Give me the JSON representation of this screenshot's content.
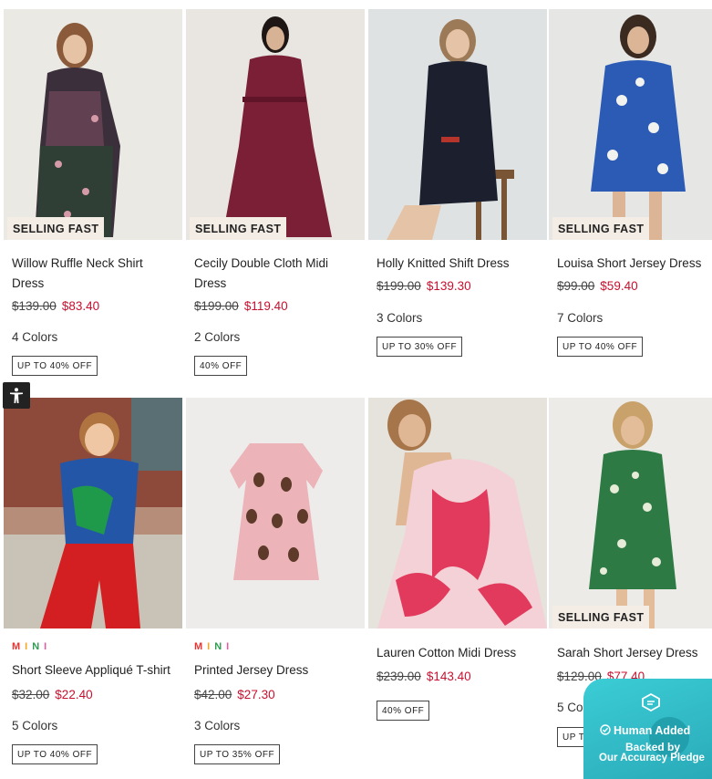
{
  "products": [
    {
      "badge": "SELLING FAST",
      "name": "Willow Ruffle Neck Shirt Dress",
      "was": "$139.00",
      "now": "$83.40",
      "colors": "4 Colors",
      "tag": "UP TO 40% OFF"
    },
    {
      "badge": "SELLING FAST",
      "name": "Cecily Double Cloth Midi Dress",
      "was": "$199.00",
      "now": "$119.40",
      "colors": "2 Colors",
      "tag": "40% OFF"
    },
    {
      "name": "Holly Knitted Shift Dress",
      "was": "$199.00",
      "now": "$139.30",
      "colors": "3 Colors",
      "tag": "UP TO 30% OFF"
    },
    {
      "badge": "SELLING FAST",
      "name": "Louisa Short Jersey Dress",
      "was": "$99.00",
      "now": "$59.40",
      "colors": "7 Colors",
      "tag": "UP TO 40% OFF"
    },
    {
      "label": "MINI",
      "name": "Short Sleeve Appliqué T-shirt",
      "was": "$32.00",
      "now": "$22.40",
      "colors": "5 Colors",
      "tag": "UP TO 40% OFF"
    },
    {
      "label": "MINI",
      "name": "Printed Jersey Dress",
      "was": "$42.00",
      "now": "$27.30",
      "colors": "3 Colors",
      "tag": "UP TO 35% OFF"
    },
    {
      "name": "Lauren Cotton Midi Dress",
      "was": "$239.00",
      "now": "$143.40",
      "tag": "40% OFF"
    },
    {
      "badge": "SELLING FAST",
      "name": "Sarah Short Jersey Dress",
      "was": "$129.00",
      "now": "$77.40",
      "colors": "5 Colors",
      "tag": "UP TO 40% OFF"
    }
  ],
  "mini_colors": [
    "#e8312f",
    "#f5a623",
    "#2e9b4f",
    "#e75aa0"
  ],
  "pledge": {
    "line1": "Human Added",
    "line2": "Backed by",
    "line3": "Our Accuracy Pledge"
  },
  "icons": {
    "accessibility": "accessibility-icon",
    "chat": "chat-bubble-icon",
    "check": "check-circle-icon"
  },
  "colors": {
    "sale": "#c8102e",
    "badge_bg": "#f4ede6",
    "pledge": "#3bcdd6"
  }
}
